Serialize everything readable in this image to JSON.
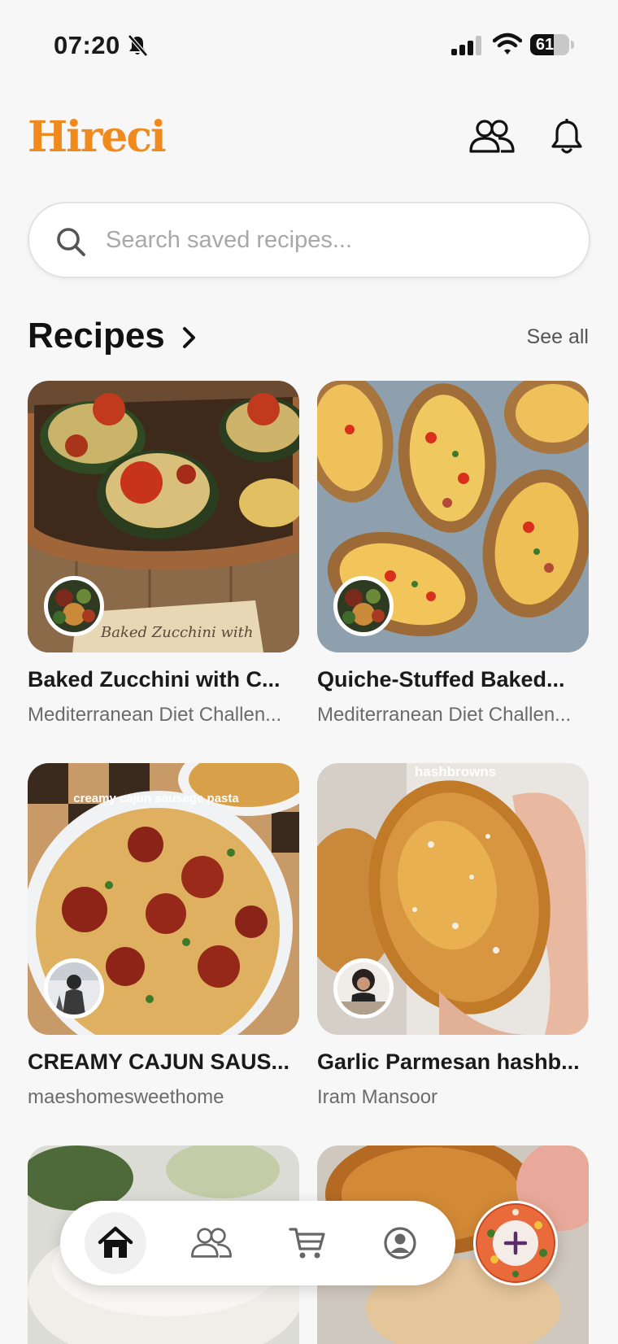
{
  "status_bar": {
    "time": "07:20",
    "battery": "61",
    "battery_level": 0.61
  },
  "header": {
    "logo": "Hireci"
  },
  "search": {
    "placeholder": "Search saved recipes..."
  },
  "section": {
    "title": "Recipes",
    "see_all": "See all"
  },
  "recipes": [
    {
      "title": "Baked Zucchini with C...",
      "author": "Mediterranean Diet Challen...",
      "image_caption": "Baked Zucchini with"
    },
    {
      "title": "Quiche-Stuffed Baked...",
      "author": "Mediterranean Diet Challen...",
      "image_caption": ""
    },
    {
      "title": "CREAMY CAJUN SAUS...",
      "author": "maeshomesweethome",
      "image_caption": "creamy cajun sausage pasta"
    },
    {
      "title": "Garlic Parmesan hashb...",
      "author": "Iram Mansoor",
      "image_caption": "hashbrowns"
    }
  ],
  "nav": {
    "items": [
      "home-icon",
      "friends-icon",
      "cart-icon",
      "profile-icon"
    ],
    "active": "home"
  },
  "colors": {
    "brand": "#f08a1c",
    "background": "#f7f7f7"
  }
}
